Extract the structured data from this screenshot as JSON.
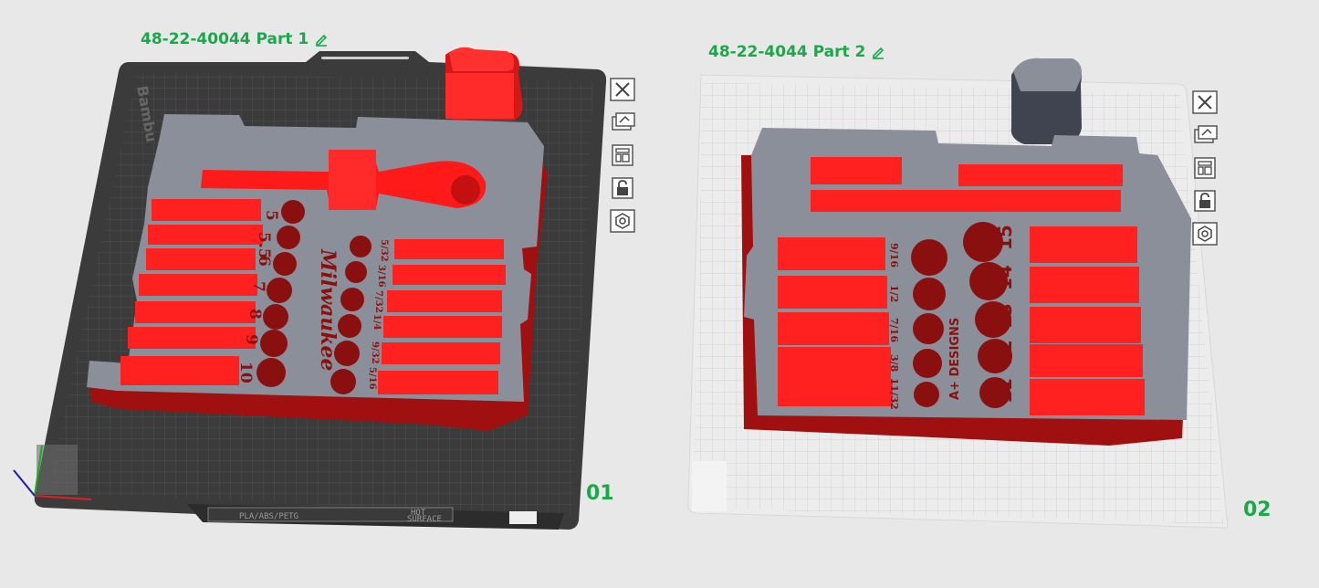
{
  "plates": [
    {
      "title": "48-22-40044 Part 1",
      "number": "01",
      "bed_label": "PLA/ABS/PETG",
      "hot_label_1": "HOT",
      "hot_label_2": "SURFACE",
      "bed_brand": "Bambu",
      "tray_left_numbers": [
        "5",
        "5.5",
        "6",
        "7",
        "8",
        "9",
        "10"
      ],
      "tray_right_labels": [
        "5/32",
        "3/16",
        "7/32",
        "1/4",
        "9/32",
        "5/16"
      ],
      "brand_text": "Milwaukee"
    },
    {
      "title": "48-22-4044 Part 2",
      "number": "02",
      "tray_left_labels": [
        "9/16",
        "1/2",
        "7/16",
        "3/8",
        "11/32"
      ],
      "tray_right_numbers": [
        "15",
        "14",
        "13",
        "12",
        "11"
      ],
      "brand_text": "A+ DESIGNS"
    }
  ],
  "toolbar_icons": [
    "close-icon",
    "auto-orient-icon",
    "arrange-icon",
    "lock-icon",
    "settings-icon"
  ],
  "colors": {
    "accent_green": "#1aa84a",
    "part_red": "#ff2020",
    "part_gray": "#8b8f99",
    "plate_dark": "#3a3a3a",
    "plate_light": "#dcdcdc"
  }
}
